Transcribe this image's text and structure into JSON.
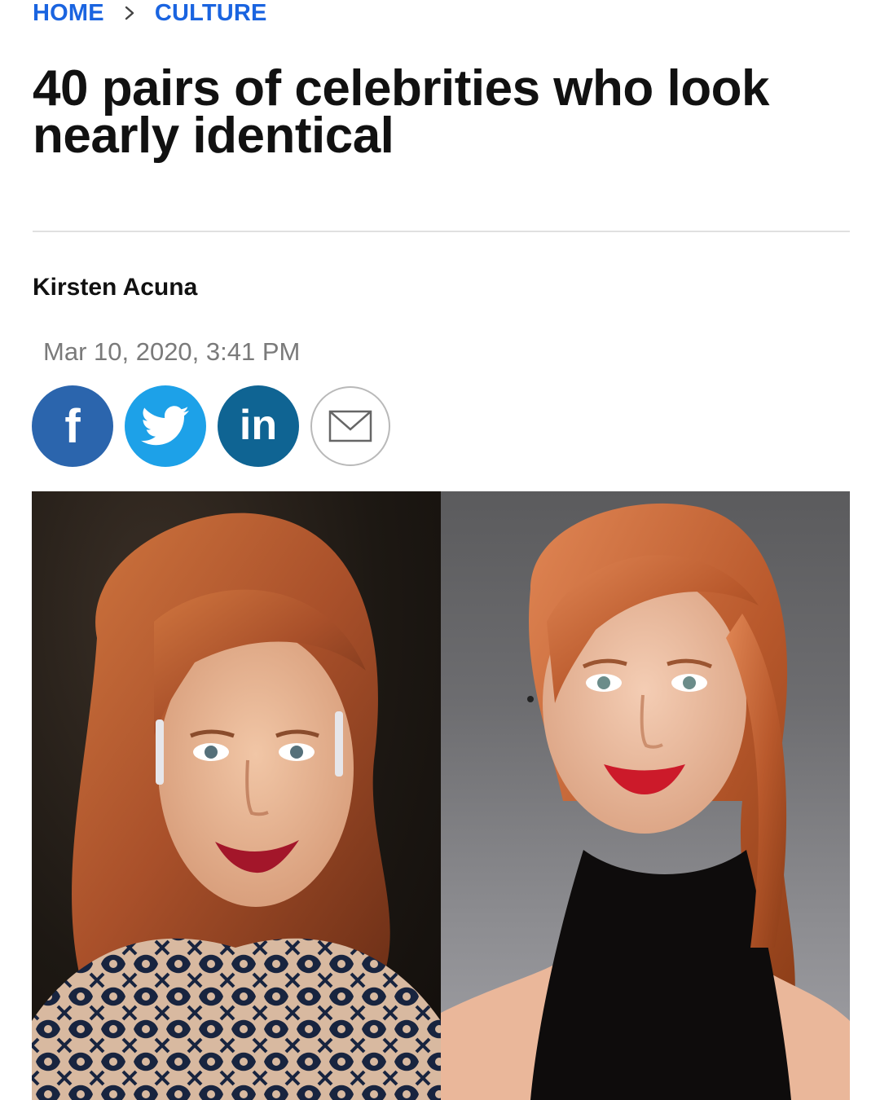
{
  "breadcrumb": {
    "items": [
      "HOME",
      "CULTURE"
    ]
  },
  "article": {
    "headline": "40 pairs of celebrities who look nearly identical",
    "author": "Kirsten Acuna",
    "timestamp": "Mar 10, 2020, 3:41 PM"
  },
  "share": {
    "facebook_label": "f",
    "twitter_icon": "twitter-bird-icon",
    "linkedin_label": "in",
    "email_icon": "envelope-icon"
  },
  "colors": {
    "link_blue": "#1a64e0",
    "facebook": "#2b65ad",
    "twitter": "#1da1e8",
    "linkedin": "#0f6493",
    "muted_text": "#7a7a7a"
  },
  "hero_image": {
    "panels": [
      "left-portrait",
      "right-portrait"
    ]
  }
}
